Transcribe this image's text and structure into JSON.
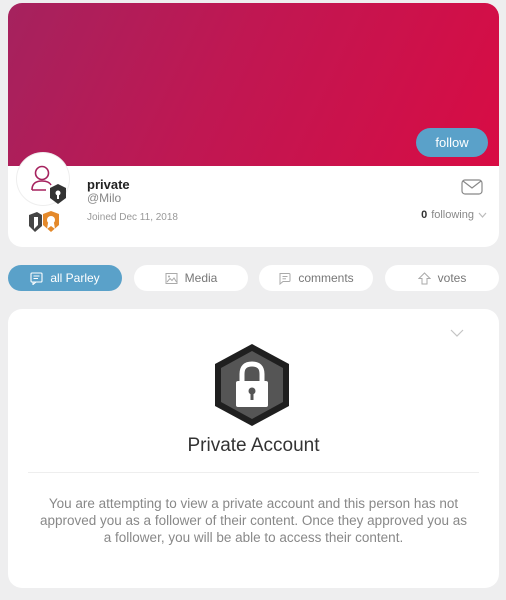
{
  "profile": {
    "follow_label": "follow",
    "name": "private",
    "handle": "@Milo",
    "joined": "Joined Dec 11, 2018",
    "following_count": "0",
    "following_label": "following",
    "icons": [
      "user-icon",
      "lock-icon",
      "mail-icon",
      "chevron-down-icon"
    ]
  },
  "tabs": [
    {
      "label": "all Parley",
      "icon": "chat-icon",
      "active": true
    },
    {
      "label": "Media",
      "icon": "image-icon",
      "active": false
    },
    {
      "label": "comments",
      "icon": "comment-icon",
      "active": false
    },
    {
      "label": "votes",
      "icon": "upvote-icon",
      "active": false
    }
  ],
  "private_notice": {
    "title": "Private Account",
    "message": "You are attempting to view a private account and this person has not approved you as a follower of their content. Once they approved you as a follower, you will be able to access their content."
  },
  "colors": {
    "banner_start": "#a5225e",
    "banner_end": "#d80c44",
    "accent": "#5aa1c9",
    "background": "#eeeeef"
  }
}
